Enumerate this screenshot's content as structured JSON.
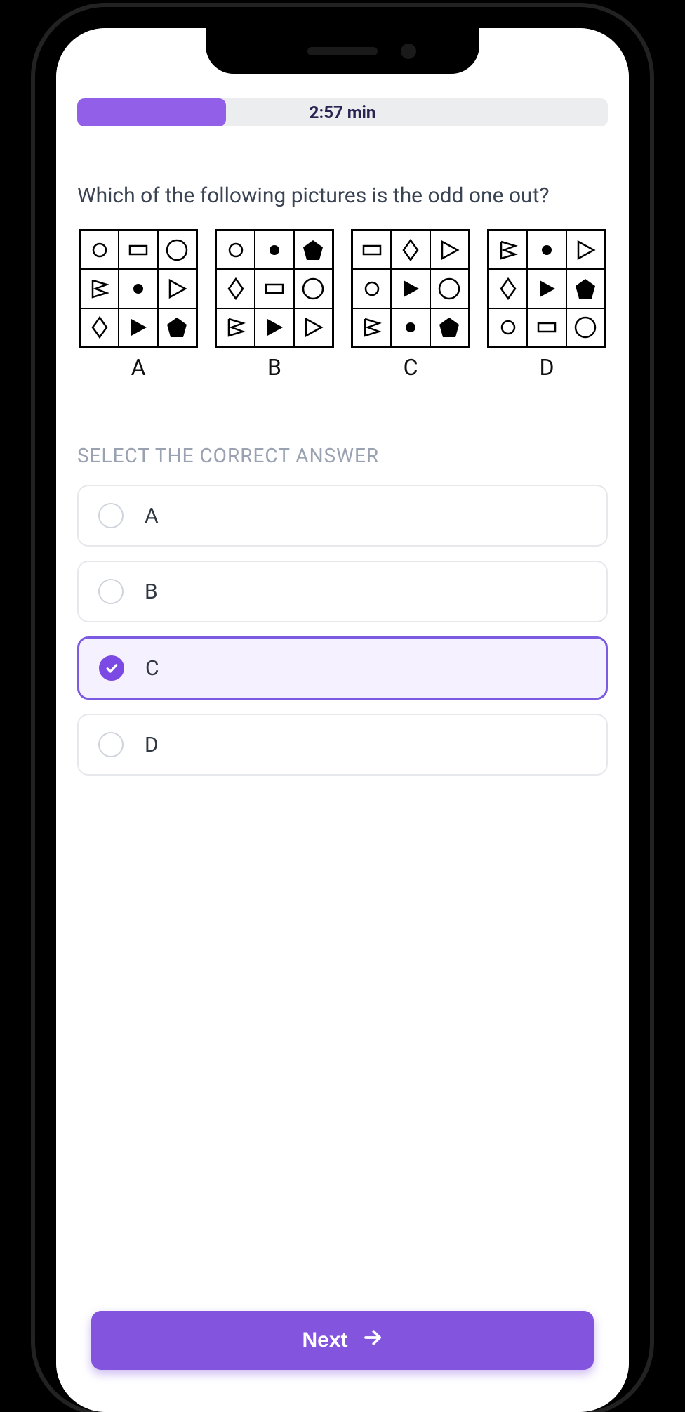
{
  "timer": "2:57 min",
  "progress_percent": 28,
  "question": "Which of the following pictures is the odd one out?",
  "grid_labels": [
    "A",
    "B",
    "C",
    "D"
  ],
  "grids": [
    [
      "circle-o",
      "rect-o",
      "circle-big-o",
      "flag-o",
      "dot",
      "triangle-o",
      "diamond-o",
      "triangle-f",
      "pentagon-f"
    ],
    [
      "circle-o",
      "dot",
      "pentagon-f",
      "diamond-o",
      "rect-o",
      "circle-big-o",
      "flag-o",
      "triangle-f",
      "triangle-o"
    ],
    [
      "rect-o",
      "diamond-o",
      "triangle-o",
      "circle-o",
      "triangle-f",
      "circle-big-o",
      "flag-o",
      "dot",
      "pentagon-f"
    ],
    [
      "flag-o",
      "dot",
      "triangle-o",
      "diamond-o",
      "triangle-f",
      "pentagon-f",
      "circle-o",
      "rect-o",
      "circle-big-o"
    ]
  ],
  "select_title": "SELECT THE CORRECT ANSWER",
  "options": [
    "A",
    "B",
    "C",
    "D"
  ],
  "selected_index": 2,
  "next_label": "Next"
}
